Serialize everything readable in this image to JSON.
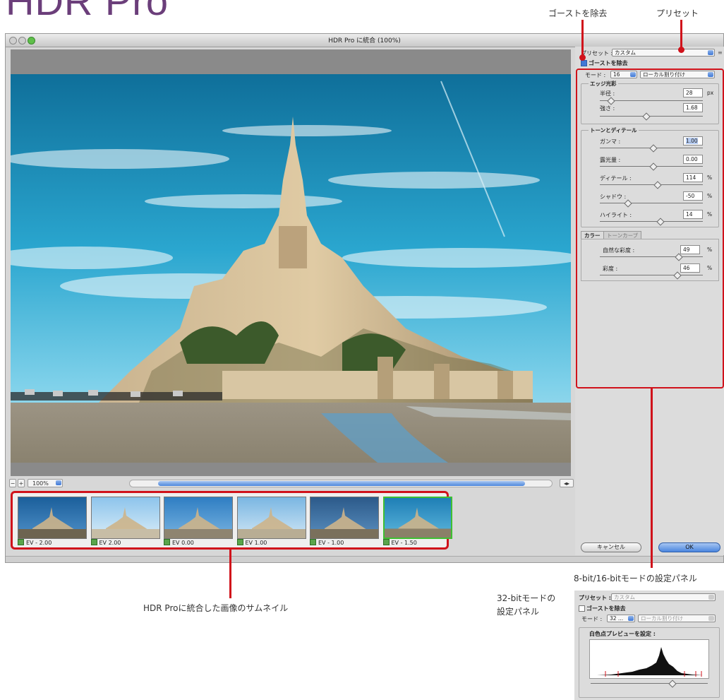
{
  "page": {
    "title": "HDR Pro"
  },
  "annotations": {
    "ghost": "ゴーストを除去",
    "preset": "プリセット",
    "panel_8_16": "8-bit/16-bitモードの設定パネル",
    "thumbs": "HDR Proに統合した画像のサムネイル",
    "panel_32_line1": "32-bitモードの",
    "panel_32_line2": "設定パネル"
  },
  "window": {
    "title": "HDR Pro に統合 (100%)",
    "zoom": "100%"
  },
  "thumbnails": [
    {
      "label": "EV - 2.00",
      "checked": true,
      "selected": false
    },
    {
      "label": "EV 2.00",
      "checked": true,
      "selected": false
    },
    {
      "label": "EV 0.00",
      "checked": true,
      "selected": false
    },
    {
      "label": "EV 1.00",
      "checked": true,
      "selected": false
    },
    {
      "label": "EV - 1.00",
      "checked": true,
      "selected": false
    },
    {
      "label": "EV - 1.50",
      "checked": true,
      "selected": true
    }
  ],
  "panel": {
    "preset_label": "プリセット :",
    "preset_value": "カスタム",
    "ghost_label": "ゴーストを除去",
    "ghost_checked": true,
    "mode_label": "モード :",
    "mode_bits": "16",
    "mode_method": "ローカル割り付け",
    "edge": {
      "title": "エッジ光彩",
      "radius_label": "半径 :",
      "radius_value": "28",
      "radius_unit": "px",
      "strength_label": "強さ :",
      "strength_value": "1.68"
    },
    "tone": {
      "title": "トーンとディテール",
      "gamma_label": "ガンマ :",
      "gamma_value": "1.00",
      "exposure_label": "露光量 :",
      "exposure_value": "0.00",
      "detail_label": "ディテール :",
      "detail_value": "114",
      "shadow_label": "シャドウ :",
      "shadow_value": "-50",
      "highlight_label": "ハイライト :",
      "highlight_value": "14",
      "percent": "%"
    },
    "color": {
      "tab_color": "カラー",
      "tab_curve": "トーンカーブ",
      "vibrance_label": "自然な彩度 :",
      "vibrance_value": "49",
      "saturation_label": "彩度 :",
      "saturation_value": "46",
      "percent": "%"
    },
    "cancel": "キャンセル",
    "ok": "OK"
  },
  "panel32": {
    "preset_label": "プリセット :",
    "preset_value": "カスタム",
    "ghost_label": "ゴーストを除去",
    "mode_label": "モード :",
    "mode_bits": "32 ...",
    "mode_method": "ローカル割り付け",
    "white_point_label": "白色点プレビューを設定 :"
  },
  "colors": {
    "accent_red": "#d0121b",
    "title_purple": "#6b3e7a",
    "ok_blue": "#4a86df"
  }
}
